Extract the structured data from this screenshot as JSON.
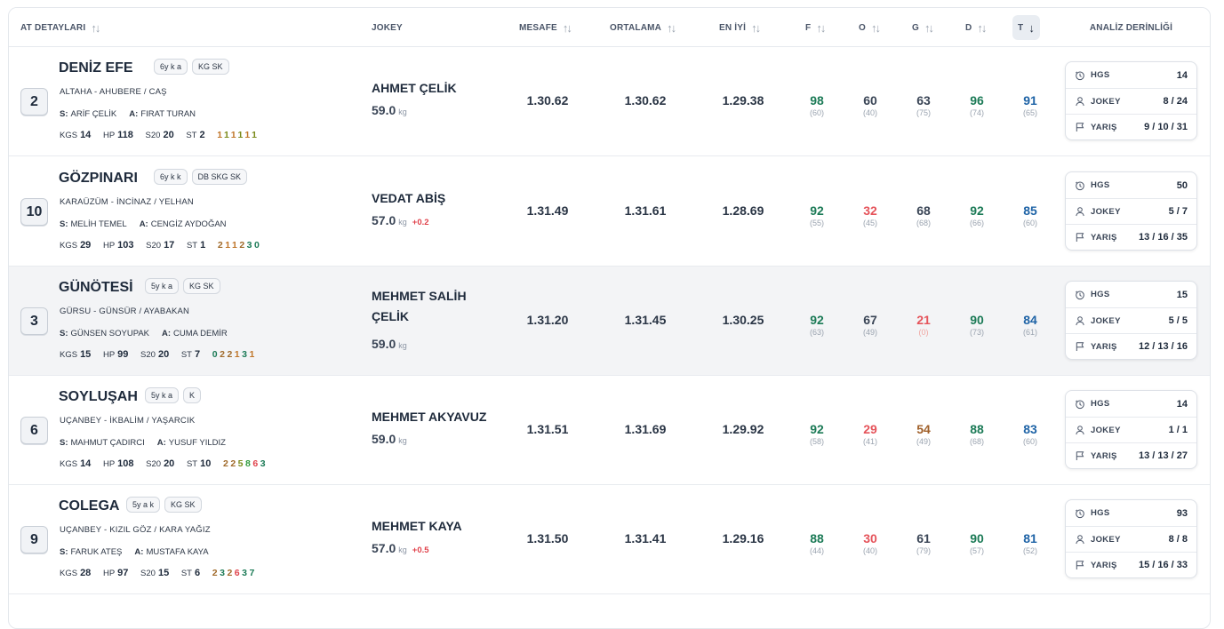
{
  "headers": {
    "horse": "AT DETAYLARI",
    "jockey": "JOKEY",
    "distance": "MESAFE",
    "average": "ORTALAMA",
    "best": "EN İYİ",
    "f": "F",
    "o": "O",
    "g": "G",
    "d": "D",
    "t": "T",
    "analysis": "ANALİZ DERİNLİĞİ",
    "sort_icon": "sort-both-icon",
    "sort_active_icon": "arrow-down-icon"
  },
  "labels": {
    "sire_prefix": "S:",
    "trainer_prefix": "A:",
    "kgs": "KGS",
    "hp": "HP",
    "s20": "S20",
    "st": "ST",
    "kg": "kg",
    "hgs": "HGS",
    "jokey": "JOKEY",
    "yaris": "YARIŞ"
  },
  "colors": {
    "green": "#1b7a56",
    "red": "#e5535a",
    "blue": "#1e63a6",
    "orange": "#a0602a"
  },
  "rows": [
    {
      "number": "2",
      "name": "DENİZ EFE",
      "tags": [
        "6y k a",
        "KG SK"
      ],
      "pedigree": "ALTAHA - AHUBERE / CAŞ",
      "sire": "ARİF ÇELİK",
      "trainer": "FIRAT TURAN",
      "kgs": "14",
      "hp": "118",
      "s20": "20",
      "st": "2",
      "form": "111111",
      "jockey": "AHMET ÇELİK",
      "weight": "59.0",
      "weight_diff": "",
      "distance": "1.30.62",
      "average": "1.30.62",
      "best": "1.29.38",
      "f": {
        "v": "98",
        "s": "(60)"
      },
      "o": {
        "v": "60",
        "s": "(40)"
      },
      "g": {
        "v": "63",
        "s": "(75)"
      },
      "d": {
        "v": "96",
        "s": "(74)"
      },
      "t": {
        "v": "91",
        "s": "(65)"
      },
      "hgs": "14",
      "jokey_ratio": "8 / 24",
      "race_ratio": "9 / 10 / 31"
    },
    {
      "number": "10",
      "name": "GÖZPINARI",
      "tags": [
        "6y k k",
        "DB SKG SK"
      ],
      "pedigree": "KARAÜZÜM - İNCİNAZ / YELHAN",
      "sire": "MELİH TEMEL",
      "trainer": "CENGİZ AYDOĞAN",
      "kgs": "29",
      "hp": "103",
      "s20": "17",
      "st": "1",
      "form": "211230",
      "jockey": "VEDAT ABİŞ",
      "weight": "57.0",
      "weight_diff": "+0.2",
      "distance": "1.31.49",
      "average": "1.31.61",
      "best": "1.28.69",
      "f": {
        "v": "92",
        "s": "(55)"
      },
      "o": {
        "v": "32",
        "s": "(45)"
      },
      "g": {
        "v": "68",
        "s": "(68)"
      },
      "d": {
        "v": "92",
        "s": "(66)"
      },
      "t": {
        "v": "85",
        "s": "(60)"
      },
      "hgs": "50",
      "jokey_ratio": "5 / 7",
      "race_ratio": "13 / 16 / 35"
    },
    {
      "number": "3",
      "name": "GÜNÖTESİ",
      "tags": [
        "5y k a",
        "KG SK"
      ],
      "pedigree": "GÜRSU - GÜNSÜR / AYABAKAN",
      "sire": "GÜNSEN SOYUPAK",
      "trainer": "CUMA DEMİR",
      "kgs": "15",
      "hp": "99",
      "s20": "20",
      "st": "7",
      "form": "022131",
      "jockey": "MEHMET SALİH ÇELİK",
      "weight": "59.0",
      "weight_diff": "",
      "distance": "1.31.20",
      "average": "1.31.45",
      "best": "1.30.25",
      "f": {
        "v": "92",
        "s": "(63)"
      },
      "o": {
        "v": "67",
        "s": "(49)"
      },
      "g": {
        "v": "21",
        "s": "(0)"
      },
      "d": {
        "v": "90",
        "s": "(73)"
      },
      "t": {
        "v": "84",
        "s": "(61)"
      },
      "hgs": "15",
      "jokey_ratio": "5 / 5",
      "race_ratio": "12 / 13 / 16"
    },
    {
      "number": "6",
      "name": "SOYLUŞAH",
      "tags": [
        "5y k a",
        "K"
      ],
      "pedigree": "UÇANBEY - İKBALİM / YAŞARCIK",
      "sire": "MAHMUT ÇADIRCI",
      "trainer": "YUSUF YILDIZ",
      "kgs": "14",
      "hp": "108",
      "s20": "20",
      "st": "10",
      "form": "225863",
      "jockey": "MEHMET AKYAVUZ",
      "weight": "59.0",
      "weight_diff": "",
      "distance": "1.31.51",
      "average": "1.31.69",
      "best": "1.29.92",
      "f": {
        "v": "92",
        "s": "(58)"
      },
      "o": {
        "v": "29",
        "s": "(41)"
      },
      "g": {
        "v": "54",
        "s": "(49)"
      },
      "d": {
        "v": "88",
        "s": "(68)"
      },
      "t": {
        "v": "83",
        "s": "(60)"
      },
      "hgs": "14",
      "jokey_ratio": "1 / 1",
      "race_ratio": "13 / 13 / 27"
    },
    {
      "number": "9",
      "name": "COLEGA",
      "tags": [
        "5y a k",
        "KG SK"
      ],
      "pedigree": "UÇANBEY - KIZIL GÖZ / KARA YAĞIZ",
      "sire": "FARUK ATEŞ",
      "trainer": "MUSTAFA KAYA",
      "kgs": "28",
      "hp": "97",
      "s20": "15",
      "st": "6",
      "form": "232637",
      "jockey": "MEHMET KAYA",
      "weight": "57.0",
      "weight_diff": "+0.5",
      "distance": "1.31.50",
      "average": "1.31.41",
      "best": "1.29.16",
      "f": {
        "v": "88",
        "s": "(44)"
      },
      "o": {
        "v": "30",
        "s": "(40)"
      },
      "g": {
        "v": "61",
        "s": "(79)"
      },
      "d": {
        "v": "90",
        "s": "(57)"
      },
      "t": {
        "v": "81",
        "s": "(52)"
      },
      "hgs": "93",
      "jokey_ratio": "8 / 8",
      "race_ratio": "15 / 16 / 33"
    }
  ]
}
